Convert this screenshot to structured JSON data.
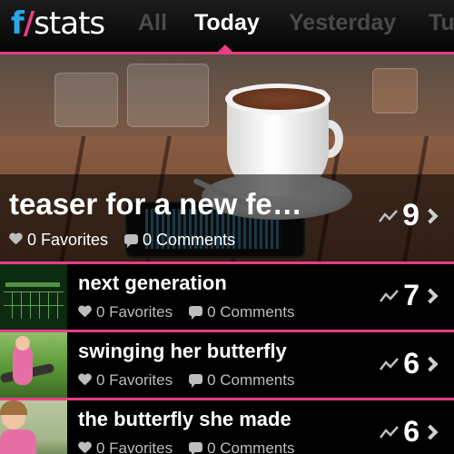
{
  "header": {
    "logo": {
      "f": "f",
      "slash": "/",
      "stats": "stats"
    },
    "tabs": [
      {
        "label": "All",
        "active": false
      },
      {
        "label": "Today",
        "active": true
      },
      {
        "label": "Yesterday",
        "active": false
      },
      {
        "label": "Tu",
        "active": false
      }
    ]
  },
  "featured": {
    "title": "teaser for a new fe…",
    "favorites": "0 Favorites",
    "comments": "0 Comments",
    "score": "9"
  },
  "items": [
    {
      "title": "next generation",
      "favorites": "0 Favorites",
      "comments": "0 Comments",
      "score": "7"
    },
    {
      "title": "swinging her butterfly",
      "favorites": "0 Favorites",
      "comments": "0 Comments",
      "score": "6"
    },
    {
      "title": "the butterfly she made",
      "favorites": "0 Favorites",
      "comments": "0 Comments",
      "score": "6"
    }
  ],
  "colors": {
    "accent": "#e83d86",
    "brand_blue": "#2aa7e8",
    "tab_inactive": "#4a4a4a"
  }
}
